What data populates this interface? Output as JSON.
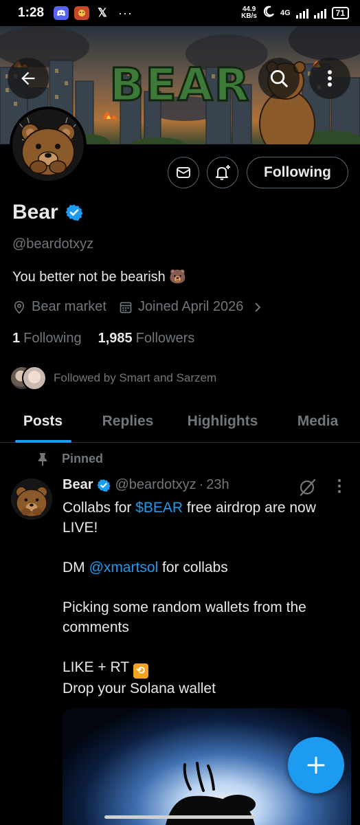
{
  "status_bar": {
    "time": "1:28",
    "apps": [
      "discord-icon",
      "game-icon",
      "x-icon"
    ],
    "x_glyph": "𝕏",
    "more": "···",
    "speed_value": "44.9",
    "speed_unit": "KB/s",
    "network": "4G",
    "battery": "71"
  },
  "banner": {
    "title_art": "BEAR"
  },
  "profile": {
    "name": "Bear",
    "verified": true,
    "handle": "@beardotxyz",
    "bio": "You better not be bearish 🐻",
    "location": "Bear market",
    "joined": "Joined April 2026",
    "following_count": "1",
    "following_label": "Following",
    "followers_count": "1,985",
    "followers_label": "Followers",
    "followed_by": "Followed by Smart and Sarzem",
    "follow_button": "Following"
  },
  "tabs": [
    {
      "label": "Posts",
      "active": true
    },
    {
      "label": "Replies",
      "active": false
    },
    {
      "label": "Highlights",
      "active": false
    },
    {
      "label": "Media",
      "active": false
    }
  ],
  "pinned_post": {
    "pinned_label": "Pinned",
    "author_name": "Bear",
    "author_handle": "@beardotxyz",
    "separator": "·",
    "time": "23h",
    "more": "⋮",
    "line1_prefix": "Collabs for ",
    "line1_link": "$BEAR",
    "line1_suffix": " free airdrop are now LIVE!",
    "line2_prefix": "DM ",
    "line2_link": "@xmartsol",
    "line2_suffix": " for collabs",
    "line3": "Picking some random wallets from the comments",
    "line4": "LIKE + RT",
    "line5": "Drop your Solana wallet"
  },
  "colors": {
    "accent": "#1d9bf0",
    "muted": "#71767b",
    "text": "#e7e9ea",
    "border": "#2f3336"
  }
}
